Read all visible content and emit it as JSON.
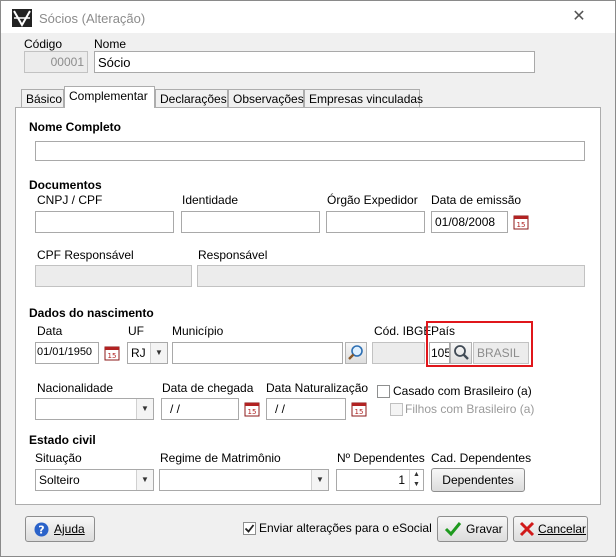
{
  "window": {
    "title": "Sócios (Alteração)",
    "close_glyph": "✕"
  },
  "header": {
    "codigo_label": "Código",
    "codigo_value": "00001",
    "nome_label": "Nome",
    "nome_value": "Sócio"
  },
  "tabs": [
    {
      "label": "Básico"
    },
    {
      "label": "Complementar"
    },
    {
      "label": "Declarações"
    },
    {
      "label": "Observações"
    },
    {
      "label": "Empresas vinculadas"
    }
  ],
  "nome_completo": {
    "label": "Nome Completo",
    "value": ""
  },
  "documentos": {
    "section": "Documentos",
    "cnpj_label": "CNPJ / CPF",
    "identidade_label": "Identidade",
    "orgao_label": "Órgão Expedidor",
    "data_emissao_label": "Data de emissão",
    "data_emissao_value": "01/08/2008",
    "cpf_resp_label": "CPF Responsável",
    "responsavel_label": "Responsável"
  },
  "nascimento": {
    "section": "Dados do nascimento",
    "data_label": "Data",
    "data_value": "01/01/1950",
    "uf_label": "UF",
    "uf_value": "RJ",
    "municipio_label": "Município",
    "cod_ibge_label": "Cód. IBGE",
    "pais_label": "País",
    "pais_code": "105",
    "pais_name": "BRASIL",
    "nacionalidade_label": "Nacionalidade",
    "data_chegada_label": "Data de chegada",
    "data_chegada_value": "/ /",
    "data_natur_label": "Data Naturalização",
    "data_natur_value": "/ /",
    "casado_label": "Casado com Brasileiro (a)",
    "filhos_label": "Filhos com Brasileiro (a)"
  },
  "estado_civil": {
    "section": "Estado civil",
    "situacao_label": "Situação",
    "situacao_value": "Solteiro",
    "regime_label": "Regime de Matrimônio",
    "dependentes_label": "Nº Dependentes",
    "dependentes_value": "1",
    "cad_dep_label": "Cad. Dependentes",
    "dependentes_button": "Dependentes"
  },
  "footer": {
    "ajuda": "Ajuda",
    "esocial": "Enviar alterações para o eSocial",
    "gravar": "Gravar",
    "cancelar": "Cancelar"
  },
  "colors": {
    "highlight": "#e0161b",
    "ok_green": "#1f9a1f",
    "cancel_red": "#d11a1a",
    "help_blue": "#2a62c9"
  }
}
